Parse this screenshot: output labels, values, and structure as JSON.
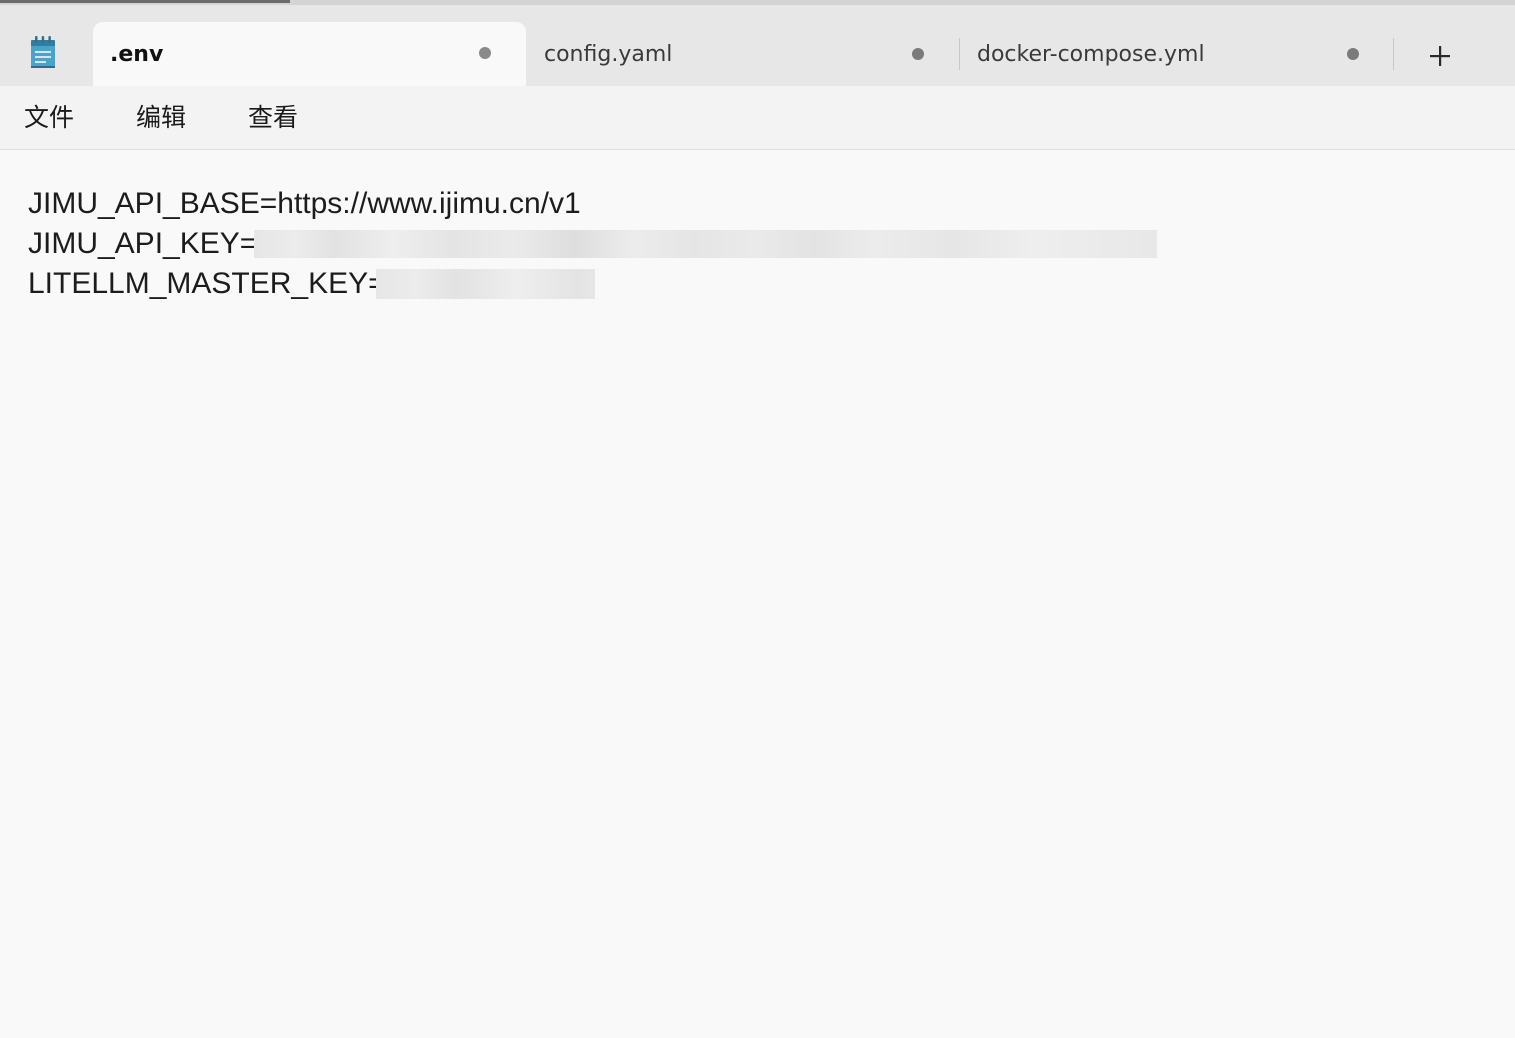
{
  "tabs": [
    {
      "label": ".env",
      "active": true,
      "modified": true
    },
    {
      "label": "config.yaml",
      "active": false,
      "modified": true
    },
    {
      "label": "docker-compose.yml",
      "active": false,
      "modified": true
    }
  ],
  "menu": {
    "file": "文件",
    "edit": "编辑",
    "view": "查看"
  },
  "editor": {
    "lines": [
      "JIMU_API_BASE=https://www.ijimu.cn/v1",
      "JIMU_API_KEY=",
      "LITELLM_MASTER_KEY="
    ]
  },
  "icons": {
    "app": "notepad-icon",
    "modified": "unsaved-dot-icon",
    "new_tab": "plus-icon"
  },
  "colors": {
    "tab_bar": "#e7e7e7",
    "active_tab": "#f9f9f9",
    "menu_bar": "#f3f3f3",
    "editor_bg": "#f9f9f9",
    "app_icon_teal": "#4aa3c8"
  }
}
